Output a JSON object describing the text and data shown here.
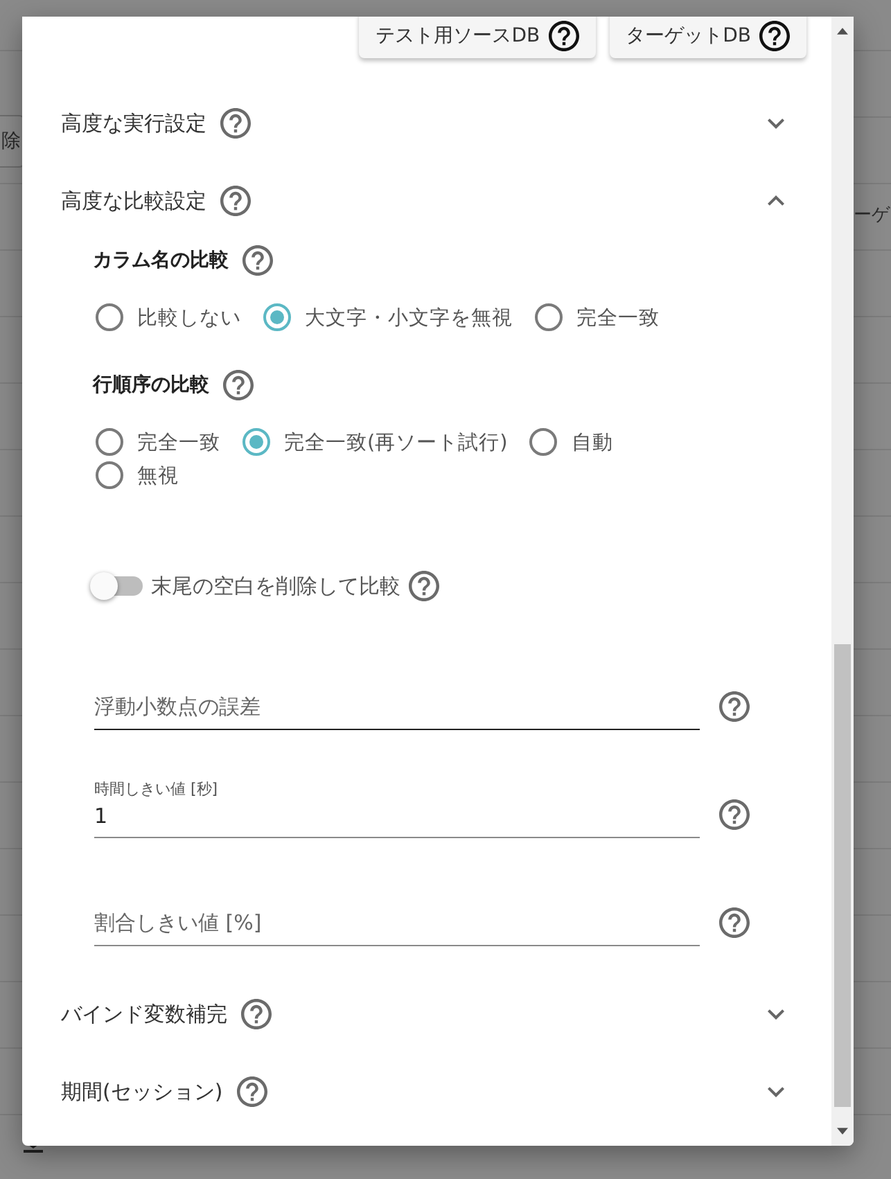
{
  "background": {
    "left_fragment": "除",
    "right_fragment": "ーゲ"
  },
  "dialog": {
    "db_buttons": [
      {
        "label": "テスト用ソースDB"
      },
      {
        "label": "ターゲットDB"
      }
    ],
    "sections": [
      {
        "title": "高度な実行設定",
        "expanded": false
      },
      {
        "title": "高度な比較設定",
        "expanded": true,
        "items": [
          {
            "kind": "radio_group",
            "title": "カラム名の比較",
            "options": [
              {
                "label": "比較しない",
                "selected": false
              },
              {
                "label": "大文字・小文字を無視",
                "selected": true
              },
              {
                "label": "完全一致",
                "selected": false
              }
            ]
          },
          {
            "kind": "radio_group",
            "title": "行順序の比較",
            "options": [
              {
                "label": "完全一致",
                "selected": false
              },
              {
                "label": "完全一致(再ソート試行)",
                "selected": true
              },
              {
                "label": "自動",
                "selected": false
              },
              {
                "label": "無視",
                "selected": false
              }
            ]
          },
          {
            "kind": "toggle",
            "label": "末尾の空白を削除して比較",
            "on": false
          },
          {
            "kind": "field",
            "label": "浮動小数点の誤差",
            "hovered": true
          },
          {
            "kind": "field",
            "label": "時間しきい値 [秒]",
            "value": "1",
            "hovered": false
          },
          {
            "kind": "field",
            "label": "割合しきい値 [%]",
            "hovered": false
          }
        ]
      },
      {
        "title": "バインド変数補完",
        "expanded": false
      },
      {
        "title": "期間(セッション)",
        "expanded": false
      }
    ]
  }
}
